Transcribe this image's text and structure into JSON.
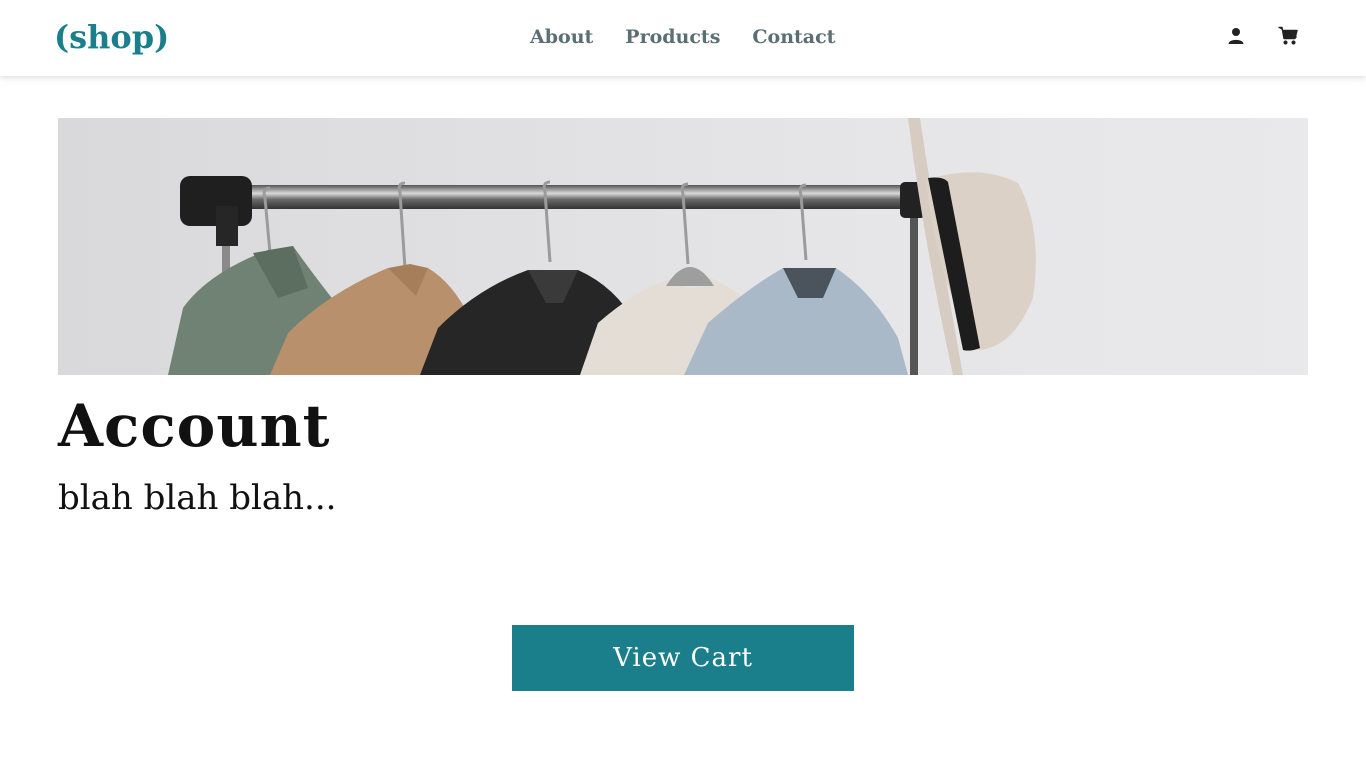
{
  "brand": {
    "logo_text": "(shop)",
    "accent_color": "#1a7f8a"
  },
  "nav": {
    "links": [
      {
        "label": "About"
      },
      {
        "label": "Products"
      },
      {
        "label": "Contact"
      }
    ],
    "icons": [
      "user-icon",
      "cart-icon"
    ]
  },
  "hero": {
    "image": "clothing-rack-photo"
  },
  "main": {
    "title": "Account",
    "text": "blah blah blah...",
    "view_cart_label": "View Cart"
  }
}
